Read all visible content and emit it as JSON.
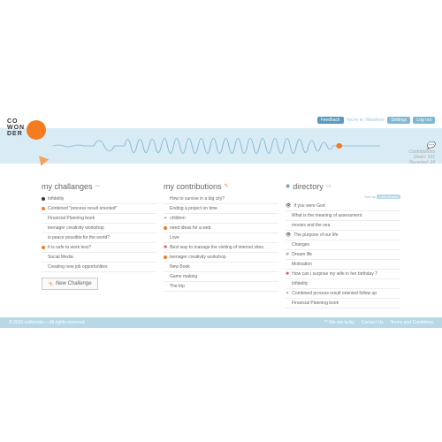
{
  "brand": {
    "line1": "CO",
    "line2": "WON",
    "line3": "DER"
  },
  "topbar": {
    "feedback": "Feedback",
    "greeting": "You're in, Wanderer",
    "settings": "Settings",
    "logout": "Log out"
  },
  "stats": {
    "label": "Contributions",
    "given_label": "Given:",
    "given": "531",
    "received_label": "Received:",
    "received": "34"
  },
  "columns": {
    "challenges": {
      "title": "my challanges",
      "items": [
        {
          "b": "black",
          "t": "Infidelity"
        },
        {
          "b": "orange",
          "t": "Combined \"process result oriented\""
        },
        {
          "b": "none",
          "t": "Financial Planning book"
        },
        {
          "b": "none",
          "t": "teenager creativity workshop"
        },
        {
          "b": "none",
          "t": "is peace possible for the world?"
        },
        {
          "b": "orange",
          "t": "It is safe to work less?"
        },
        {
          "b": "none",
          "t": "Social Media"
        },
        {
          "b": "none",
          "t": "Creating new job opportunities"
        }
      ],
      "new_btn": "New Challenge"
    },
    "contributions": {
      "title": "my contributions",
      "items": [
        {
          "b": "none",
          "t": "How to survive in a big city?"
        },
        {
          "b": "none",
          "t": "Ending a project on time"
        },
        {
          "b": "green",
          "t": "children"
        },
        {
          "b": "orange",
          "t": "need ideas for a web."
        },
        {
          "b": "none",
          "t": "Love"
        },
        {
          "b": "red",
          "t": "Best way to manage the visiting of internet sites."
        },
        {
          "b": "orange",
          "t": "teenager creativity workshop"
        },
        {
          "b": "none",
          "t": "New Book"
        },
        {
          "b": "none",
          "t": "Game making"
        },
        {
          "b": "none",
          "t": "The trip"
        }
      ]
    },
    "directory": {
      "title": "directory",
      "sortby_label": "Sort by",
      "sortby_value": "Last viewed",
      "items": [
        {
          "b": "eye",
          "t": "If you were God"
        },
        {
          "b": "none",
          "t": "What is the meaning of assessment"
        },
        {
          "b": "none",
          "t": "movies and the sea"
        },
        {
          "b": "eye",
          "t": "The purpose of our life"
        },
        {
          "b": "none",
          "t": "Changes"
        },
        {
          "b": "blue",
          "t": "Dream life"
        },
        {
          "b": "none",
          "t": "Motivation"
        },
        {
          "b": "red",
          "t": "How can i surprise my wife in her birthday ?"
        },
        {
          "b": "none",
          "t": "Infidelity"
        },
        {
          "b": "green",
          "t": "Combined  process result oriented  follow up"
        },
        {
          "b": "none",
          "t": "Financial Planning book"
        }
      ]
    }
  },
  "footer": {
    "copyright": "© 2010 coWonder – All rights reserved",
    "lucky": "** We are lucky",
    "contact": "Contact Us",
    "terms": "Terms and Conditions"
  }
}
